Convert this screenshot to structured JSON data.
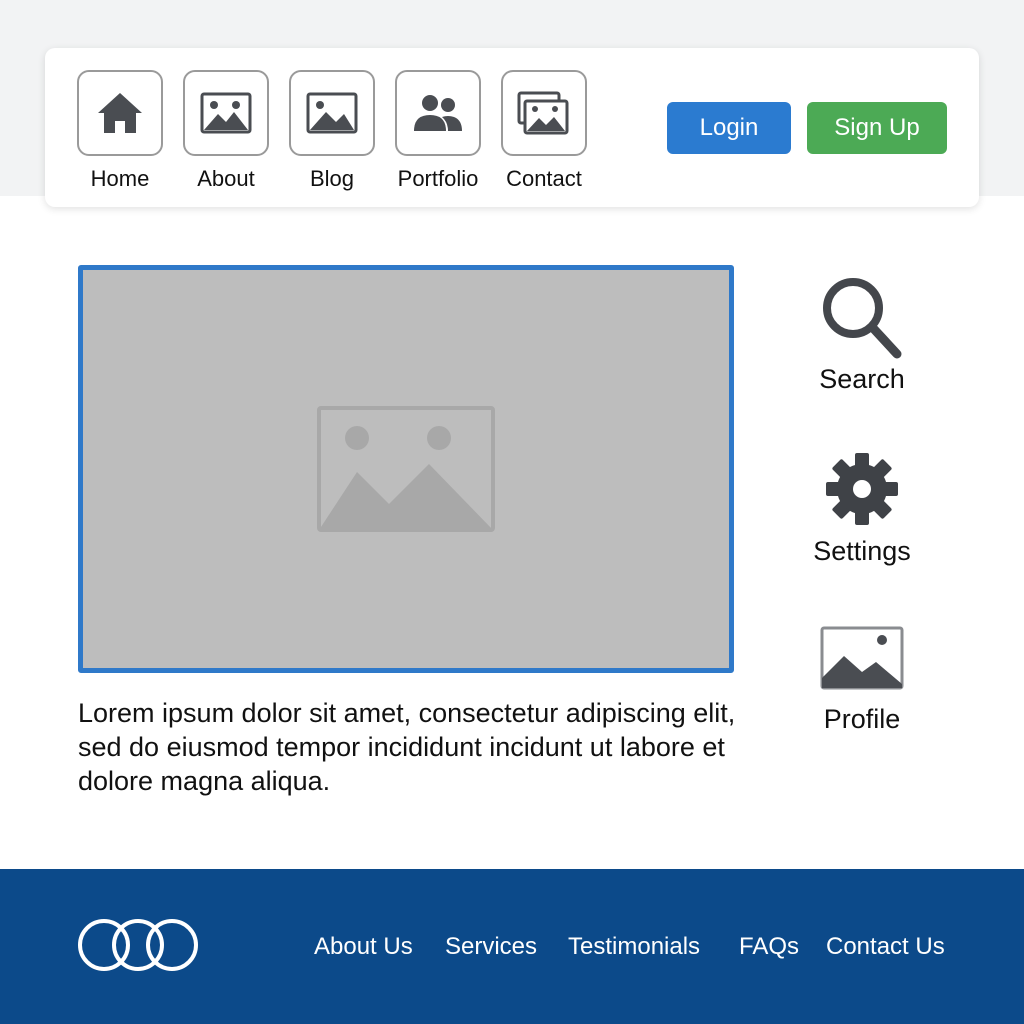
{
  "nav": {
    "items": [
      {
        "label": "Home",
        "icon": "home-icon"
      },
      {
        "label": "About",
        "icon": "image-icon"
      },
      {
        "label": "Blog",
        "icon": "image-icon"
      },
      {
        "label": "Portfolio",
        "icon": "users-icon"
      },
      {
        "label": "Contact",
        "icon": "images-icon"
      }
    ],
    "login_label": "Login",
    "signup_label": "Sign Up"
  },
  "main": {
    "body_text": "Lorem ipsum dolor sit amet, consectetur adipiscing elit, sed do eiusmod tempor incididunt incidunt ut labore et dolore magna aliqua."
  },
  "sidebar": {
    "items": [
      {
        "label": "Search",
        "icon": "search-icon"
      },
      {
        "label": "Settings",
        "icon": "gear-icon"
      },
      {
        "label": "Profile",
        "icon": "image-icon"
      }
    ]
  },
  "footer": {
    "links": [
      "About Us",
      "Services",
      "Testimonials",
      "FAQs",
      "Contact Us"
    ]
  },
  "colors": {
    "primary": "#2f79c9",
    "login": "#2b7bd0",
    "signup": "#4caa55",
    "footer": "#0c4a8a",
    "icon": "#4a4d52"
  }
}
